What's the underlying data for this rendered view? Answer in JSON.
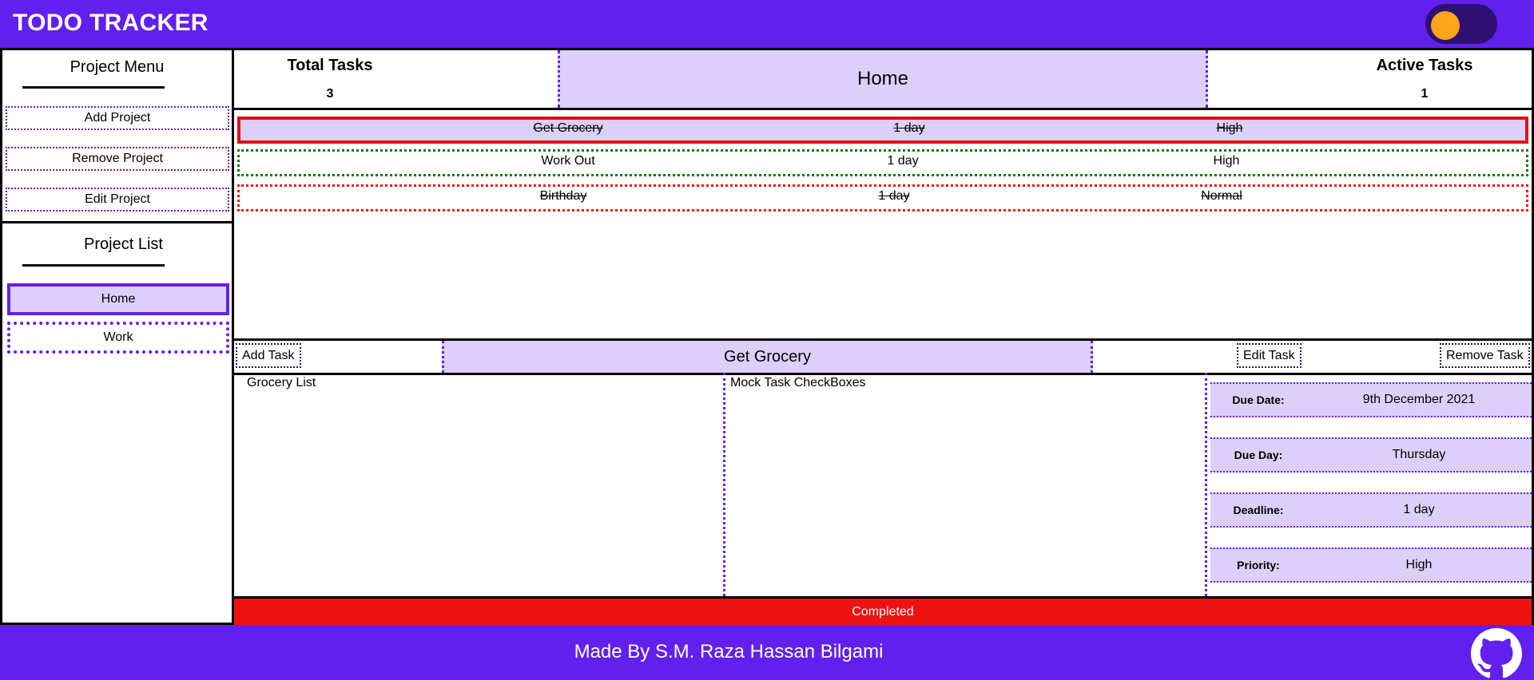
{
  "header": {
    "title": "TODO TRACKER"
  },
  "sidebar": {
    "menu_title": "Project Menu",
    "menu_buttons": [
      "Add Project",
      "Remove Project",
      "Edit Project"
    ],
    "list_title": "Project List",
    "projects": [
      {
        "name": "Home",
        "active": true
      },
      {
        "name": "Work",
        "active": false
      }
    ]
  },
  "stats": {
    "total_label": "Total Tasks",
    "total_value": "3",
    "current_project": "Home",
    "active_label": "Active Tasks",
    "active_value": "1"
  },
  "tasks": [
    {
      "name": "Get Grocery",
      "deadline": "1 day",
      "priority": "High",
      "completed": true,
      "selected": true,
      "border_color": "#e01010"
    },
    {
      "name": "Work Out",
      "deadline": "1 day",
      "priority": "High",
      "completed": false,
      "selected": false,
      "border_color": "#0a7a0a"
    },
    {
      "name": "Birthday",
      "deadline": "1 day",
      "priority": "Normal",
      "completed": true,
      "selected": false,
      "border_color": "#ee1111"
    }
  ],
  "toolbar": {
    "add_label": "Add Task",
    "selected_task": "Get Grocery",
    "edit_label": "Edit Task",
    "remove_label": "Remove Task"
  },
  "details": {
    "list_title": "Grocery List",
    "checkbox_title": "Mock Task CheckBoxes",
    "due_date_label": "Due Date:",
    "due_date": "9th December 2021",
    "due_day_label": "Due Day:",
    "due_day": "Thursday",
    "deadline_label": "Deadline:",
    "deadline": "1 day",
    "priority_label": "Priority:",
    "priority": "High"
  },
  "status": {
    "text": "Completed",
    "color": "#ee1111"
  },
  "footer": {
    "credit": "Made By S.M. Raza Hassan Bilgami",
    "icon": "github-icon"
  },
  "colors": {
    "accent": "#6120ee",
    "accent_light": "#dcd0fa",
    "toggle_knob": "#ffa41b"
  }
}
